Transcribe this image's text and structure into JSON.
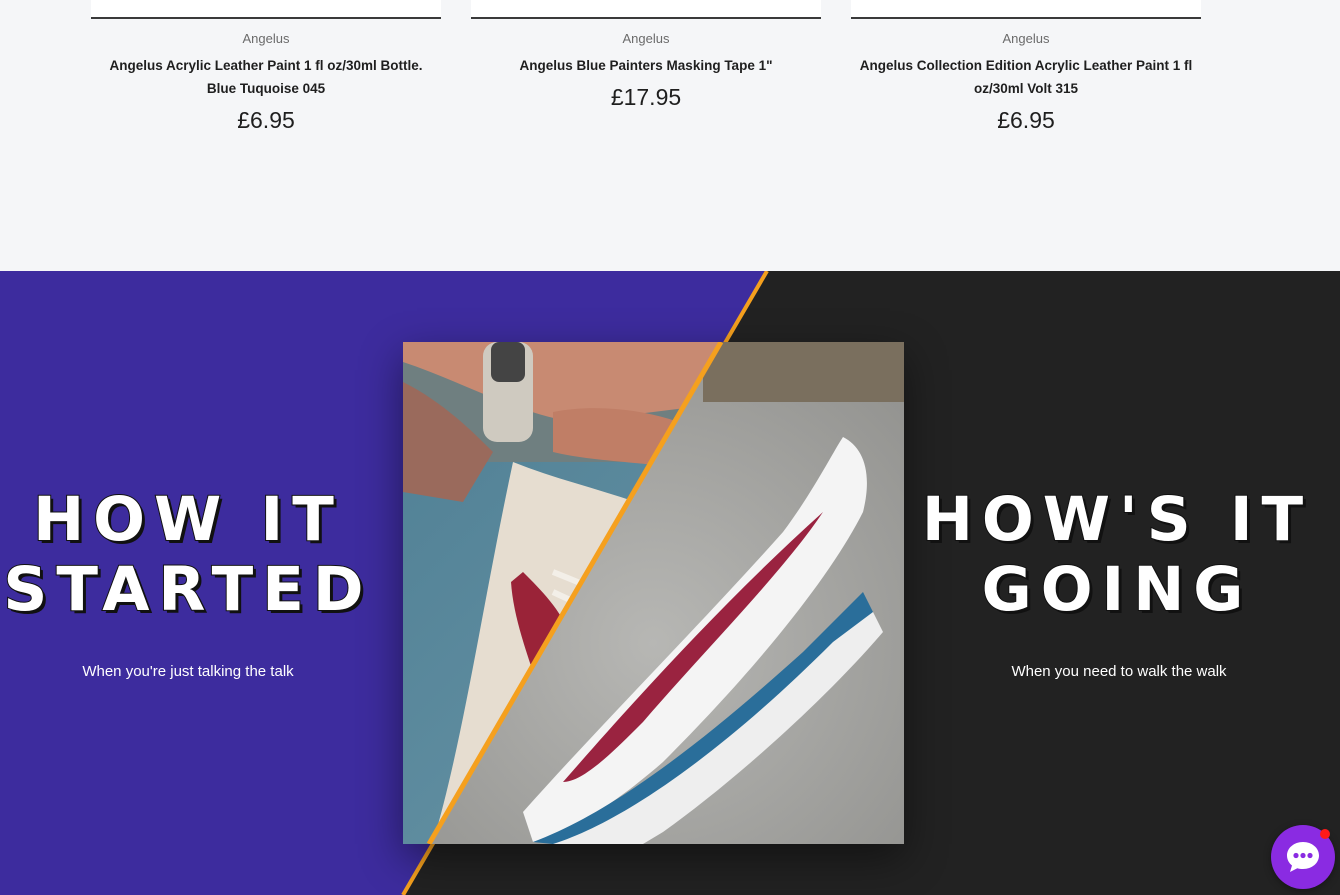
{
  "products": [
    {
      "vendor": "Angelus",
      "title_line1": "Angelus Acrylic Leather Paint 1 fl oz/30ml Bottle.",
      "title_line2": "Blue Tuquoise 045",
      "price": "£6.95"
    },
    {
      "vendor": "Angelus",
      "title_line1": "Angelus Blue Painters Masking Tape 1\"",
      "title_line2": "",
      "price": "£17.95"
    },
    {
      "vendor": "Angelus",
      "title_line1": "Angelus Collection Edition Acrylic Leather Paint 1 fl",
      "title_line2": "oz/30ml Volt 315",
      "price": "£6.95"
    }
  ],
  "promo": {
    "left": {
      "heading_line1": "HOW IT",
      "heading_line2": "STARTED",
      "subtext": "When you're just talking the talk"
    },
    "right": {
      "heading_line1": "HOW'S IT",
      "heading_line2": "GOING",
      "subtext": "When you need to walk the walk"
    }
  },
  "colors": {
    "page_background": "#f5f6f8",
    "promo_left_background": "#3d2c9e",
    "promo_right_background": "#222222",
    "divider_accent": "#f5a01e",
    "chat_button": "#8a2be2",
    "chat_notification": "#ff1a1a"
  },
  "chat": {
    "icon": "chat-bubble-icon"
  }
}
